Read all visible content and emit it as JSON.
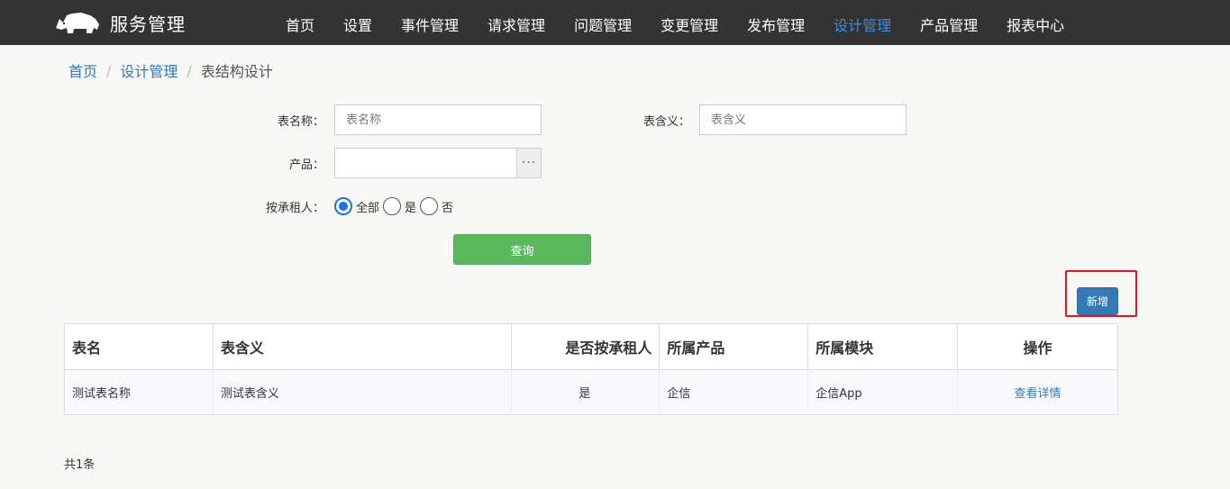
{
  "app": {
    "title": "服务管理",
    "logo_icon": "rhino-icon"
  },
  "nav": {
    "items": [
      {
        "label": "首页"
      },
      {
        "label": "设置"
      },
      {
        "label": "事件管理"
      },
      {
        "label": "请求管理"
      },
      {
        "label": "问题管理"
      },
      {
        "label": "变更管理"
      },
      {
        "label": "发布管理"
      },
      {
        "label": "设计管理"
      },
      {
        "label": "产品管理"
      },
      {
        "label": "报表中心"
      }
    ],
    "active_index": 7
  },
  "breadcrumb": {
    "home": "首页",
    "section": "设计管理",
    "current": "表结构设计"
  },
  "form": {
    "table_name": {
      "label": "表名称：",
      "value": "",
      "placeholder": "表名称"
    },
    "table_meaning": {
      "label": "表含义：",
      "value": "",
      "placeholder": "表含义"
    },
    "product": {
      "label": "产品：",
      "value": "",
      "button": "···"
    },
    "tenant": {
      "label": "按承租人：",
      "options": [
        {
          "label": "全部",
          "checked": true
        },
        {
          "label": "是",
          "checked": false
        },
        {
          "label": "否",
          "checked": false
        }
      ]
    },
    "query_label": "查询"
  },
  "add_label": "新增",
  "table": {
    "headers": [
      "表名",
      "表含义",
      "是否按承租人",
      "所属产品",
      "所属模块",
      "操作"
    ],
    "rows": [
      {
        "name": "测试表名称",
        "meaning": "测试表含义",
        "by_tenant": "是",
        "product": "企信",
        "module": "企信App",
        "action": "查看详情"
      }
    ]
  },
  "total_text": "共1条",
  "colors": {
    "topbar": "#333333",
    "nav_active": "#3c8dde",
    "query_button": "#5cb85c",
    "add_button": "#337ab7",
    "highlight": "#e8161c"
  }
}
